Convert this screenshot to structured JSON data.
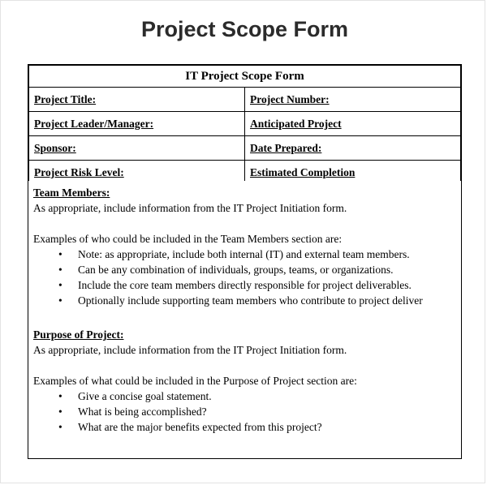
{
  "document": {
    "title": "Project Scope Form"
  },
  "form": {
    "header": "IT Project Scope Form",
    "rows": [
      {
        "left_label": "Project Title:",
        "right_label": "Project Number:"
      },
      {
        "left_label": "Project Leader/Manager:",
        "right_label": "Anticipated Project"
      },
      {
        "left_label": "Sponsor:",
        "right_label": "Date Prepared:"
      },
      {
        "left_label": "Project Risk Level:",
        "right_label": "Estimated Completion"
      }
    ]
  },
  "sections": [
    {
      "heading": "Team Members:",
      "paragraph": "As appropriate, include information from the IT Project Initiation form.",
      "examples_intro": "Examples of who could be included in the Team Members section are:",
      "bullets": [
        "Note: as appropriate, include both internal (IT) and external team members.",
        "Can be any combination of individuals, groups, teams, or organizations.",
        "Include the core team members directly responsible for project deliverables.",
        "Optionally include supporting team members who contribute to project deliver"
      ]
    },
    {
      "heading": "Purpose of Project:",
      "paragraph": "As appropriate, include information from the IT Project Initiation form.",
      "examples_intro": "Examples of what could be included in the Purpose of Project section are:",
      "bullets": [
        "Give a concise goal statement.",
        "What is being accomplished?",
        "What are the major benefits expected from this project?"
      ]
    }
  ],
  "glyphs": {
    "bullet": "•"
  }
}
